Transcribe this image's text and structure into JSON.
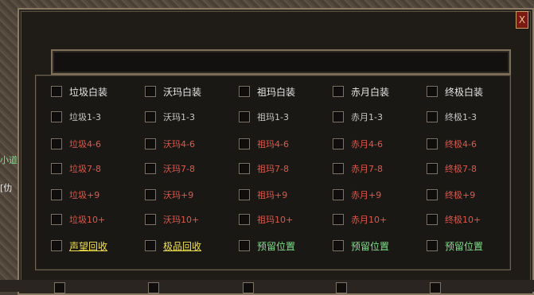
{
  "left_texts": [
    {
      "text": "小道",
      "color": "#7ee08a"
    },
    {
      "text": "[仂",
      "color": "#e8e8e8"
    }
  ],
  "window": {
    "close_label": "X",
    "grid": [
      [
        {
          "label": "垃圾白装",
          "color": "#e6e6e6",
          "checked": false
        },
        {
          "label": "沃玛白装",
          "color": "#e6e6e6",
          "checked": false
        },
        {
          "label": "祖玛白装",
          "color": "#e6e6e6",
          "checked": false
        },
        {
          "label": "赤月白装",
          "color": "#e6e6e6",
          "checked": false
        },
        {
          "label": "终极白装",
          "color": "#e6e6e6",
          "checked": false
        }
      ],
      [
        {
          "label": "垃圾1-3",
          "color": "#c8c8c8",
          "checked": false
        },
        {
          "label": "沃玛1-3",
          "color": "#c8c8c8",
          "checked": false
        },
        {
          "label": "祖玛1-3",
          "color": "#c8c8c8",
          "checked": false
        },
        {
          "label": "赤月1-3",
          "color": "#c8c8c8",
          "checked": false
        },
        {
          "label": "终极1-3",
          "color": "#c8c8c8",
          "checked": false
        }
      ],
      [
        {
          "label": "垃圾4-6",
          "color": "#e0584c",
          "checked": false
        },
        {
          "label": "沃玛4-6",
          "color": "#e0584c",
          "checked": false
        },
        {
          "label": "祖玛4-6",
          "color": "#e0584c",
          "checked": false
        },
        {
          "label": "赤月4-6",
          "color": "#e0584c",
          "checked": false
        },
        {
          "label": "终极4-6",
          "color": "#e0584c",
          "checked": false
        }
      ],
      [
        {
          "label": "垃圾7-8",
          "color": "#e0584c",
          "checked": false
        },
        {
          "label": "沃玛7-8",
          "color": "#e0584c",
          "checked": false
        },
        {
          "label": "祖玛7-8",
          "color": "#e0584c",
          "checked": false
        },
        {
          "label": "赤月7-8",
          "color": "#e0584c",
          "checked": false
        },
        {
          "label": "终极7-8",
          "color": "#e0584c",
          "checked": false
        }
      ],
      [
        {
          "label": "垃圾+9",
          "color": "#e0584c",
          "checked": false
        },
        {
          "label": "沃玛+9",
          "color": "#e0584c",
          "checked": false
        },
        {
          "label": "祖玛+9",
          "color": "#e0584c",
          "checked": false
        },
        {
          "label": "赤月+9",
          "color": "#e0584c",
          "checked": false
        },
        {
          "label": "终极+9",
          "color": "#e0584c",
          "checked": false
        }
      ],
      [
        {
          "label": "垃圾10+",
          "color": "#e0584c",
          "checked": false
        },
        {
          "label": "沃玛10+",
          "color": "#e0584c",
          "checked": false
        },
        {
          "label": "祖玛10+",
          "color": "#e0584c",
          "checked": false
        },
        {
          "label": "赤月10+",
          "color": "#e0584c",
          "checked": false
        },
        {
          "label": "终极10+",
          "color": "#e0584c",
          "checked": false
        }
      ],
      [
        {
          "label": "声望回收",
          "color": "#f2e24a",
          "checked": false,
          "underline": true
        },
        {
          "label": "极品回收",
          "color": "#f2e24a",
          "checked": false,
          "underline": true
        },
        {
          "label": "预留位置",
          "color": "#7ee08a",
          "checked": false
        },
        {
          "label": "预留位置",
          "color": "#7ee08a",
          "checked": false
        },
        {
          "label": "预留位置",
          "color": "#7ee08a",
          "checked": false
        }
      ]
    ]
  }
}
